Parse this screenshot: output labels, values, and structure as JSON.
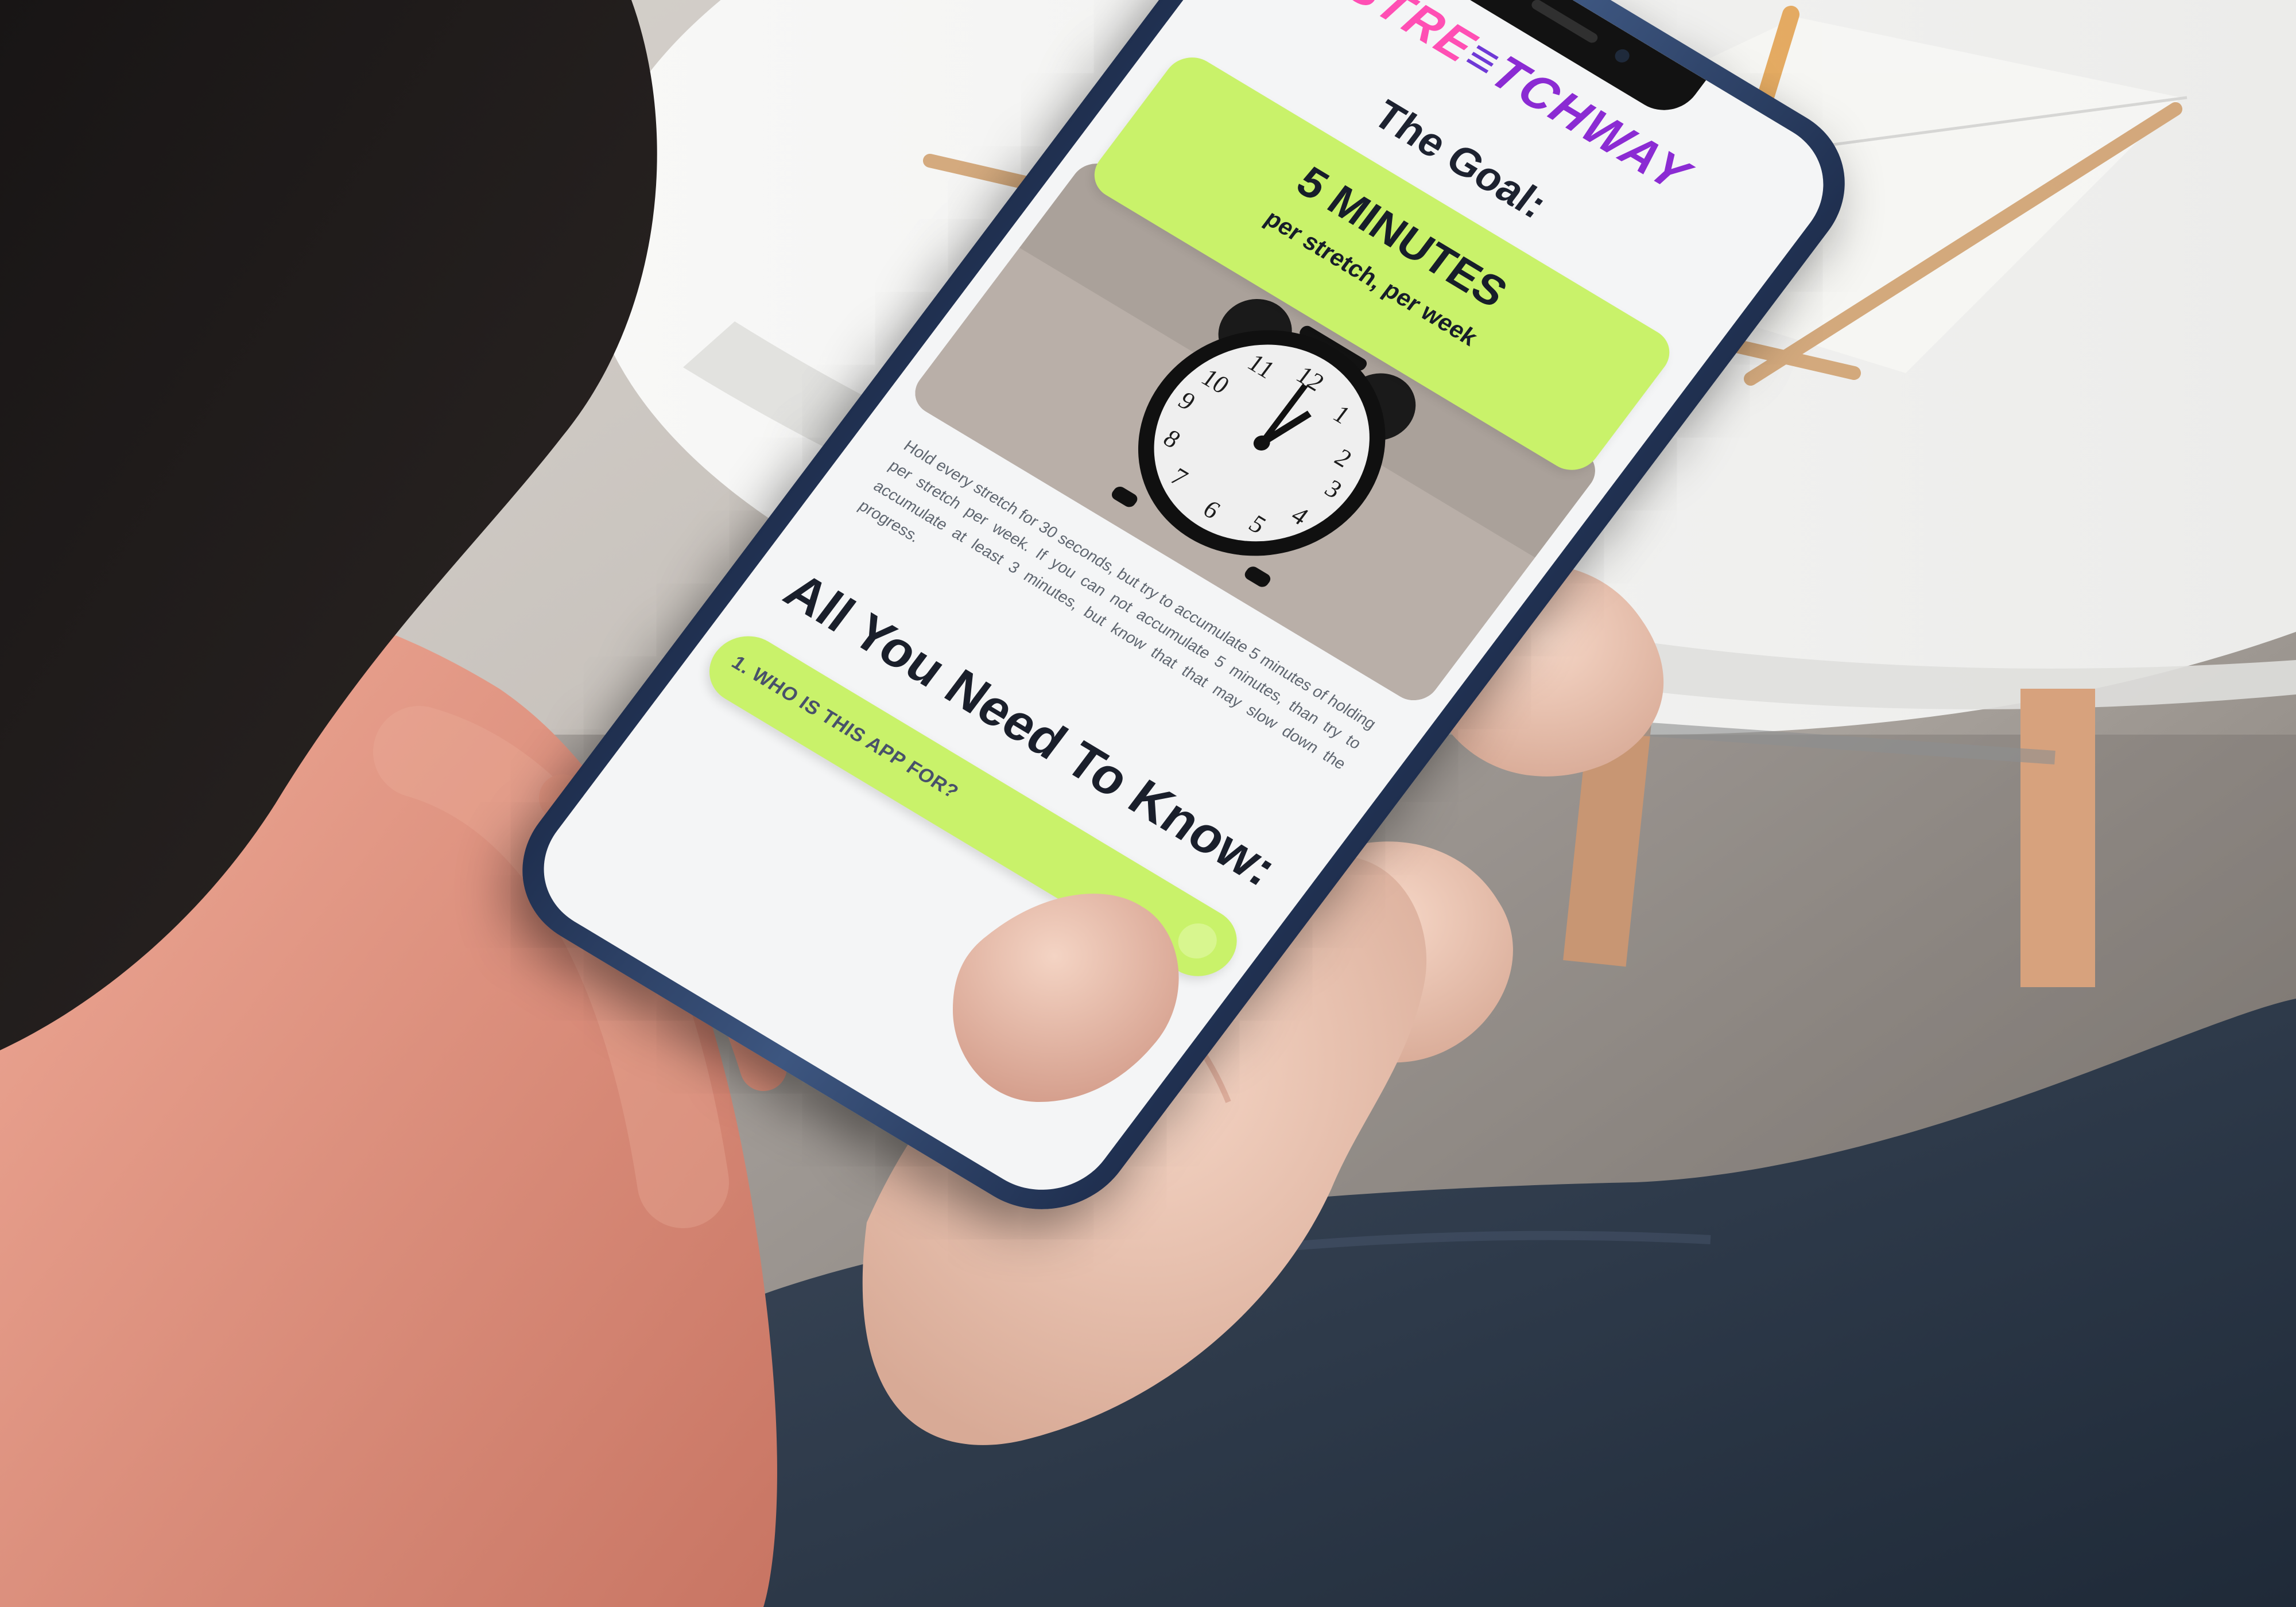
{
  "phone": {
    "logo": {
      "part1": "STRE",
      "part2": "TCHWAY"
    },
    "goal_title": "The Goal:",
    "goal_card": {
      "main": "5 MINUTES",
      "sub": "per stretch, per week"
    },
    "goal_text": "Hold every stretch for 30 seconds, but try to accumulate 5 minutes of holding per stretch per week. If you can not accumulate 5 minutes, than try to accumulate at least 3 minutes, but know that that may slow down the progress.",
    "section_title": "All You Need To Know:",
    "faq_button": {
      "label": "1. WHO IS THIS APP FOR?"
    }
  },
  "colors": {
    "accent_green": "#c9f26a",
    "logo_pink": "#ff4fb4",
    "logo_purple": "#8b2bd3"
  }
}
